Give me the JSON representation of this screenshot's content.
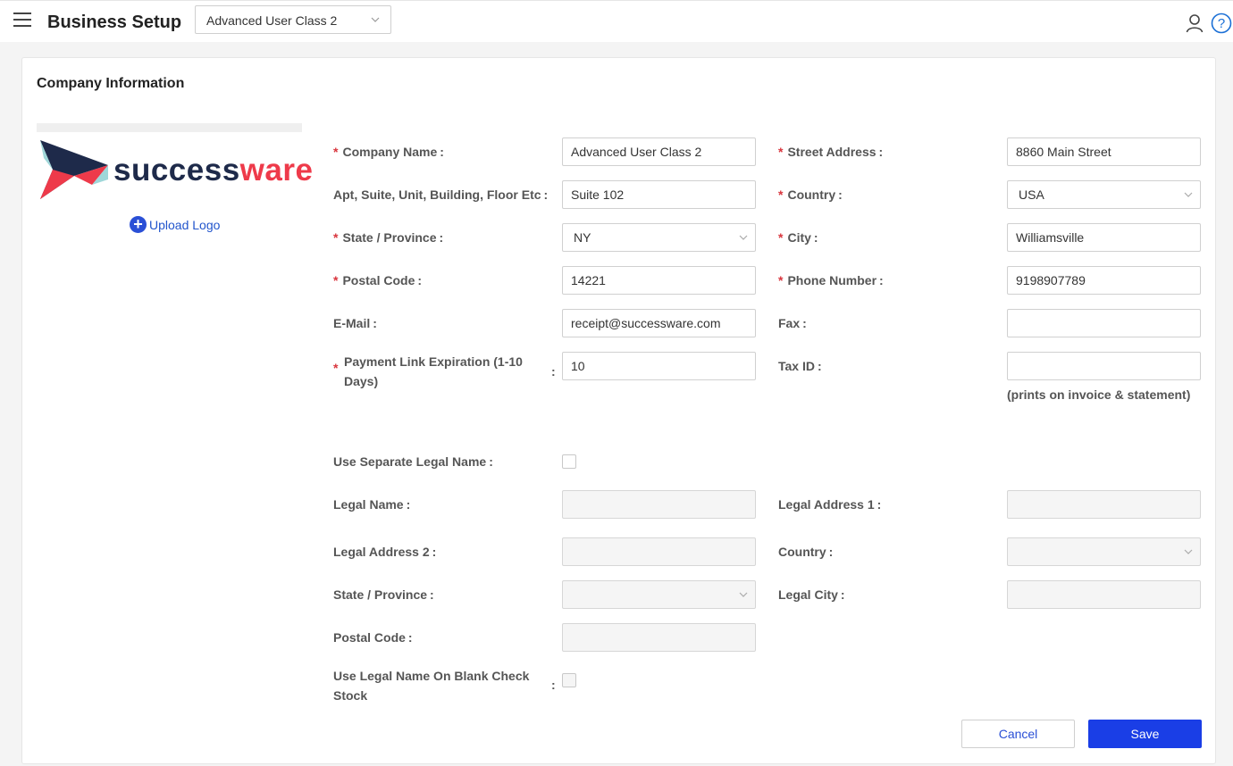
{
  "header": {
    "title": "Business Setup",
    "company_select": "Advanced User Class 2"
  },
  "card": {
    "title": "Company Information",
    "logo": {
      "part1": "success",
      "part2": "ware"
    },
    "upload_label": "Upload Logo"
  },
  "form": {
    "company_name": {
      "label": "Company Name",
      "value": "Advanced User Class 2"
    },
    "street_address": {
      "label": "Street Address",
      "value": "8860 Main Street"
    },
    "apt": {
      "label": "Apt, Suite, Unit, Building, Floor Etc",
      "value": "Suite 102"
    },
    "country": {
      "label": "Country",
      "value": "USA"
    },
    "state": {
      "label": "State / Province",
      "value": "NY"
    },
    "city": {
      "label": "City",
      "value": "Williamsville"
    },
    "postal_code": {
      "label": "Postal Code",
      "value": "14221"
    },
    "phone": {
      "label": "Phone Number",
      "value": "9198907789"
    },
    "email": {
      "label": "E-Mail",
      "value": "receipt@successware.com"
    },
    "fax": {
      "label": "Fax",
      "value": ""
    },
    "payment_link": {
      "label_line1": "Payment Link Expiration (1-10",
      "label_line2": "Days)",
      "value": "10"
    },
    "tax_id": {
      "label": "Tax ID",
      "value": "",
      "hint": "(prints on invoice & statement)"
    }
  },
  "legal": {
    "use_separate": {
      "label": "Use Separate Legal Name",
      "checked": false
    },
    "legal_name": {
      "label": "Legal Name",
      "value": ""
    },
    "legal_address1": {
      "label": "Legal Address 1",
      "value": ""
    },
    "legal_address2": {
      "label": "Legal Address 2",
      "value": ""
    },
    "country": {
      "label": "Country",
      "value": ""
    },
    "state": {
      "label": "State / Province",
      "value": ""
    },
    "legal_city": {
      "label": "Legal City",
      "value": ""
    },
    "postal_code": {
      "label": "Postal Code",
      "value": ""
    },
    "blank_check": {
      "label_line1": "Use Legal Name On Blank Check",
      "label_line2": "Stock",
      "checked": false
    }
  },
  "actions": {
    "cancel": "Cancel",
    "save": "Save"
  },
  "colors": {
    "primary": "#1a3ee6",
    "required": "#d9363e",
    "logo_navy": "#1e2a4a",
    "logo_red": "#ee3a4a"
  }
}
